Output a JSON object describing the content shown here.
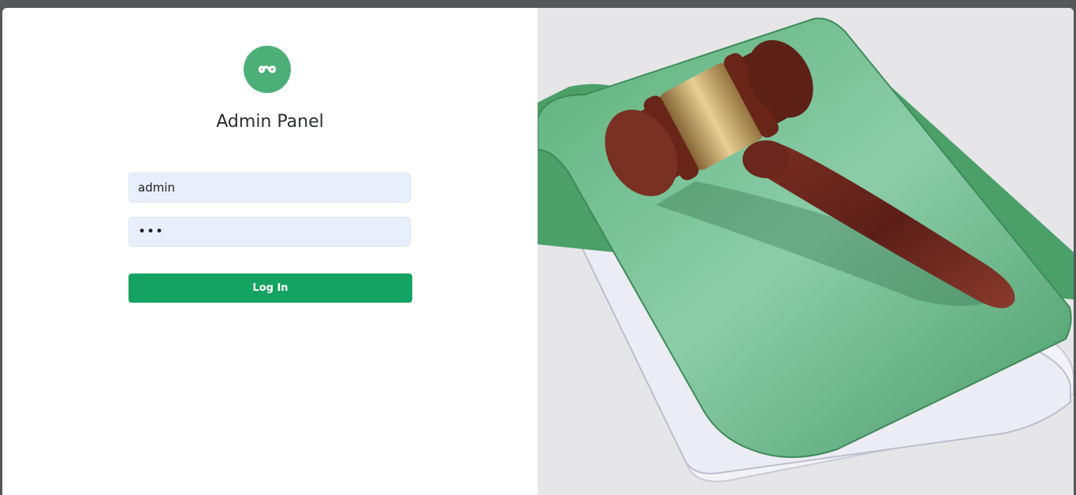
{
  "app": {
    "title": "Admin Panel",
    "brand_color": "#4caf78",
    "logo_icon": "infinity-icon"
  },
  "login": {
    "username_value": "admin",
    "password_value": "•••",
    "submit_label": "Log In",
    "submit_color": "#14a362",
    "field_bg": "#e8effc"
  },
  "hero": {
    "image_subject": "gavel-on-green-folder-icon"
  }
}
